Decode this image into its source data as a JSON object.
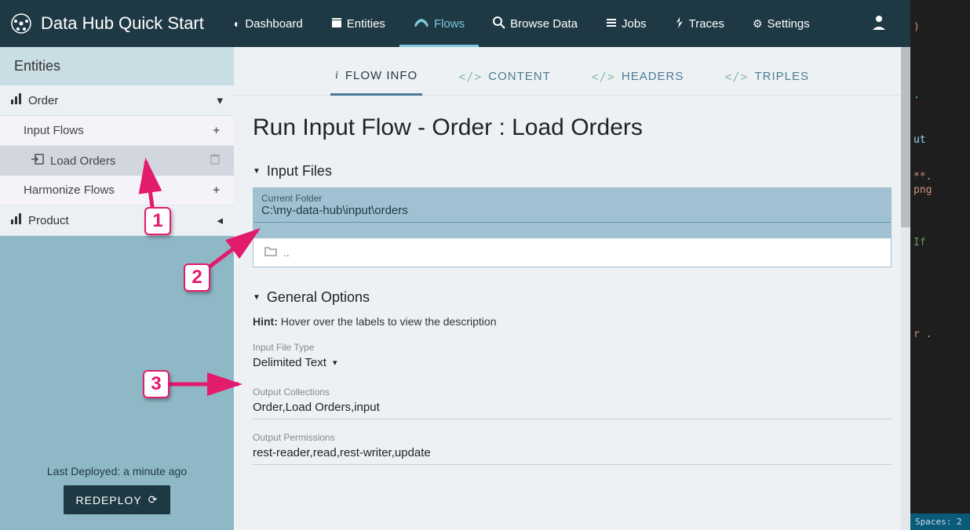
{
  "navbar": {
    "title": "Data Hub Quick Start",
    "items": [
      {
        "label": "Dashboard"
      },
      {
        "label": "Entities"
      },
      {
        "label": "Flows"
      },
      {
        "label": "Browse Data"
      },
      {
        "label": "Jobs"
      },
      {
        "label": "Traces"
      },
      {
        "label": "Settings"
      }
    ]
  },
  "sidebar": {
    "heading": "Entities",
    "entity1": "Order",
    "input_flows": "Input Flows",
    "load_orders": "Load Orders",
    "harmonize": "Harmonize Flows",
    "entity2": "Product",
    "last_deployed": "Last Deployed: a minute ago",
    "redeploy": "REDEPLOY"
  },
  "tabs": {
    "flowinfo": "FLOW INFO",
    "content": "CONTENT",
    "headers": "HEADERS",
    "triples": "TRIPLES"
  },
  "main": {
    "title": "Run Input Flow - Order : Load Orders",
    "input_files": "Input Files",
    "current_folder_label": "Current Folder",
    "current_folder_value": "C:\\my-data-hub\\input\\orders",
    "parent_dir": "..",
    "general_options": "General Options",
    "hint_bold": "Hint:",
    "hint_text": " Hover over the labels to view the description",
    "input_file_type_label": "Input File Type",
    "input_file_type_value": "Delimited Text",
    "output_collections_label": "Output Collections",
    "output_collections_value": "Order,Load Orders,input",
    "output_permissions_label": "Output Permissions",
    "output_permissions_value": "rest-reader,read,rest-writer,update"
  },
  "callouts": {
    "one": "1",
    "two": "2",
    "three": "3"
  },
  "editor": {
    "lines": [
      ")",
      ".",
      "ut",
      "**.",
      "png",
      "If",
      "r .",
      ""
    ],
    "status": "Spaces: 2"
  }
}
